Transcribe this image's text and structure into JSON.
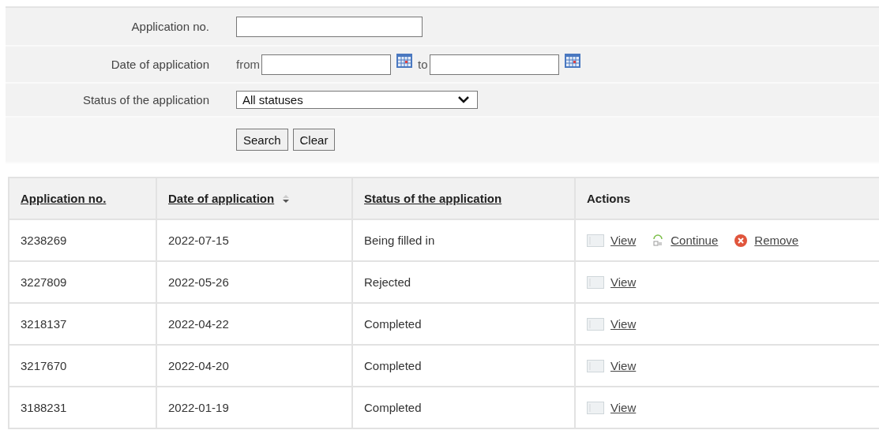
{
  "filters": {
    "application_no": {
      "label": "Application no."
    },
    "date": {
      "label": "Date of application",
      "from_label": "from",
      "to_label": "to"
    },
    "status": {
      "label": "Status of the application",
      "value": "All statuses"
    },
    "buttons": [
      "Search",
      "Clear"
    ]
  },
  "table": {
    "columns": [
      {
        "label": "Application no.",
        "link": true,
        "sortable": false
      },
      {
        "label": "Date of application",
        "link": true,
        "sortable": true
      },
      {
        "label": "Status of the application",
        "link": true,
        "sortable": false
      },
      {
        "label": "Actions",
        "link": false,
        "sortable": false
      }
    ],
    "rows": [
      {
        "number": "3238269",
        "date": "2022-07-15",
        "status": "Being filled in",
        "actions": [
          {
            "kind": "view",
            "label": "View"
          },
          {
            "kind": "continue",
            "label": "Continue"
          },
          {
            "kind": "remove",
            "label": "Remove"
          }
        ]
      },
      {
        "number": "3227809",
        "date": "2022-05-26",
        "status": "Rejected",
        "actions": [
          {
            "kind": "view",
            "label": "View"
          }
        ]
      },
      {
        "number": "3218137",
        "date": "2022-04-22",
        "status": "Completed",
        "actions": [
          {
            "kind": "view",
            "label": "View"
          }
        ]
      },
      {
        "number": "3217670",
        "date": "2022-04-20",
        "status": "Completed",
        "actions": [
          {
            "kind": "view",
            "label": "View"
          }
        ]
      },
      {
        "number": "3188231",
        "date": "2022-01-19",
        "status": "Completed",
        "actions": [
          {
            "kind": "view",
            "label": "View"
          }
        ]
      }
    ]
  }
}
